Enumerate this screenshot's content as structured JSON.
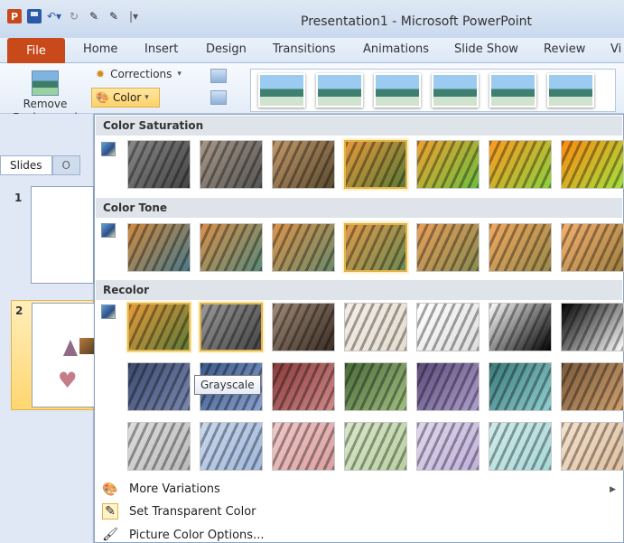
{
  "window": {
    "title": "Presentation1 - Microsoft PowerPoint"
  },
  "qat": {
    "app_icon": "P"
  },
  "tabs": [
    "File",
    "Home",
    "Insert",
    "Design",
    "Transitions",
    "Animations",
    "Slide Show",
    "Review",
    "Vi"
  ],
  "ribbon": {
    "remove_background": "Remove Background",
    "corrections": "Corrections",
    "color": "Color"
  },
  "slide_pane": {
    "tabs": [
      "Slides",
      "O"
    ],
    "slides": [
      "1",
      "2"
    ]
  },
  "dropdown": {
    "sections": [
      "Color Saturation",
      "Color Tone",
      "Recolor"
    ],
    "tooltip": "Grayscale",
    "menu": [
      "More Variations",
      "Set Transparent Color",
      "Picture Color Options..."
    ]
  },
  "colors": {
    "file_tab": "#c84a1b",
    "selection_border": "#e2b34c",
    "section_header_bg": "#dfe3ea"
  }
}
